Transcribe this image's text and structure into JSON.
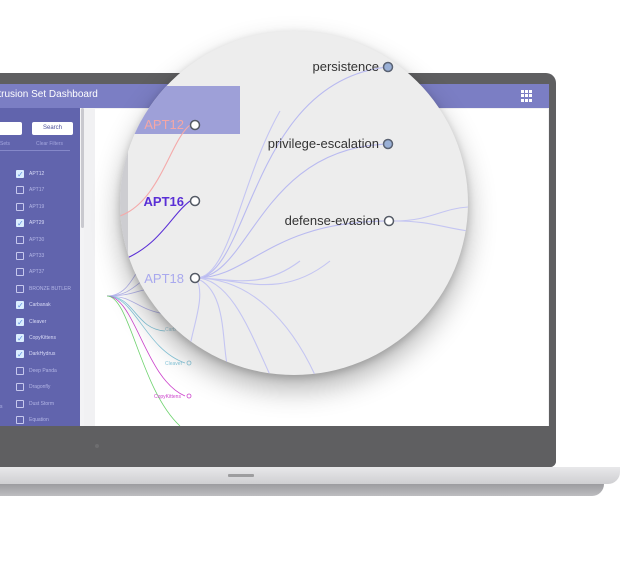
{
  "app": {
    "title": "Intrusion Set Dashboard",
    "apps_icon": "grid-apps-icon"
  },
  "sidebar": {
    "search_button": "Search",
    "links": [
      "Sets",
      "Clear Filters"
    ],
    "items": [
      {
        "label": "APT12",
        "checked": true
      },
      {
        "label": "APT17",
        "checked": false
      },
      {
        "label": "APT19",
        "checked": false
      },
      {
        "label": "APT29",
        "checked": true
      },
      {
        "label": "APT30",
        "checked": false
      },
      {
        "label": "APT33",
        "checked": false
      },
      {
        "label": "APT37",
        "checked": false
      },
      {
        "label": "BRONZE BUTLER",
        "checked": false
      },
      {
        "label": "Carbanak",
        "checked": true
      },
      {
        "label": "Cleaver",
        "checked": true
      },
      {
        "label": "CopyKittens",
        "checked": true
      },
      {
        "label": "DarkHydrus",
        "checked": true
      },
      {
        "label": "Deep Panda",
        "checked": false
      },
      {
        "label": "Dragonfly",
        "checked": false
      },
      {
        "label": "Dust Storm",
        "checked": false
      },
      {
        "label": "Equation",
        "checked": false
      }
    ],
    "side_label": "s"
  },
  "tree": {
    "small_labels": [
      "Cleaver",
      "CopyKittens",
      "Carb"
    ],
    "colors": {
      "apt12": "#f09a9a",
      "apt16": "#5a2fd6",
      "apt18": "#a9a9ee",
      "cleaver": "#88c8dc",
      "copykittens": "#cc44cc",
      "green": "#6fd36f"
    }
  },
  "lens": {
    "groups": [
      "APT12",
      "APT16",
      "APT18"
    ],
    "tactics": [
      "persistence",
      "privilege-escalation",
      "defense-evasion"
    ]
  }
}
